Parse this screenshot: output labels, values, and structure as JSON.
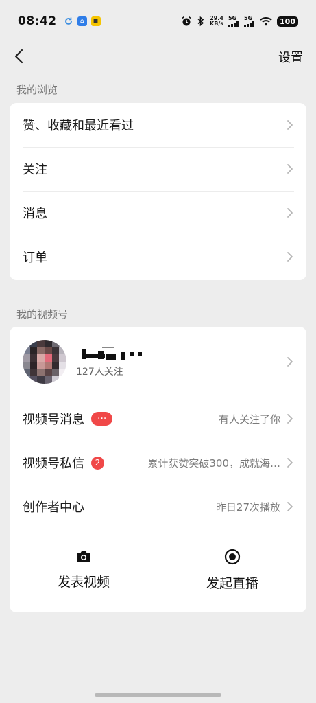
{
  "status_bar": {
    "time": "08:42",
    "speed_value": "29.4",
    "speed_unit": "KB/s",
    "network_1": "5G",
    "network_2": "5G",
    "battery": "100"
  },
  "nav": {
    "settings_label": "设置"
  },
  "browse_section": {
    "title": "我的浏览",
    "items": [
      {
        "label": "赞、收藏和最近看过"
      },
      {
        "label": "关注"
      },
      {
        "label": "消息"
      },
      {
        "label": "订单"
      }
    ]
  },
  "channels_section": {
    "title": "我的视频号",
    "profile": {
      "followers": "127人关注"
    },
    "messages": {
      "label": "视频号消息",
      "badge": "···",
      "value": "有人关注了你"
    },
    "private_messages": {
      "label": "视频号私信",
      "badge": "2",
      "value": "累计获赞突破300，成就海…"
    },
    "creator_center": {
      "label": "创作者中心",
      "value": "昨日27次播放"
    },
    "actions": {
      "post_video": "发表视频",
      "start_live": "发起直播"
    }
  },
  "icons": {
    "back": "chevron-left-icon",
    "chevron": "chevron-right-icon",
    "camera": "camera-icon",
    "live": "live-record-icon"
  },
  "colors": {
    "background": "#ededed",
    "card": "#ffffff",
    "badge": "#f04848"
  }
}
